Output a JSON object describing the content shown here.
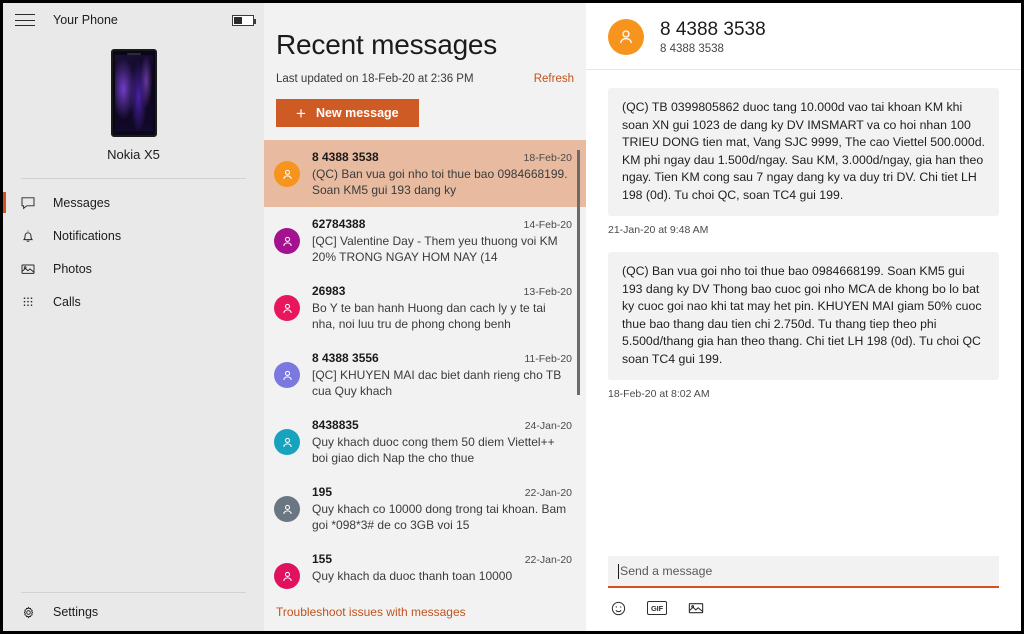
{
  "window": {
    "title": "Your Phone",
    "menu_icon": "hamburger-icon",
    "battery_icon": "battery-icon"
  },
  "sidebar": {
    "device": {
      "name": "Nokia X5",
      "thumbnail": "phone-thumbnail"
    },
    "items": [
      {
        "label": "Messages",
        "icon": "chat-bubble-icon",
        "active": true
      },
      {
        "label": "Notifications",
        "icon": "bell-icon",
        "active": false
      },
      {
        "label": "Photos",
        "icon": "photo-icon",
        "active": false
      },
      {
        "label": "Calls",
        "icon": "dialpad-icon",
        "active": false
      }
    ],
    "settings": {
      "label": "Settings",
      "icon": "gear-icon"
    }
  },
  "list_pane": {
    "title": "Recent messages",
    "last_updated": "Last updated on 18-Feb-20 at 2:36 PM",
    "refresh_label": "Refresh",
    "new_message_label": "New message",
    "new_message_plus": "+",
    "troubleshoot_label": "Troubleshoot issues with messages",
    "conversations": [
      {
        "name": "8 4388 3538",
        "date": "18-Feb-20",
        "preview": "(QC) Ban vua goi nho toi thue bao 0984668199. Soan KM5 gui 193 dang ky",
        "avatar_color": "#f7941d",
        "selected": true
      },
      {
        "name": "62784388",
        "date": "14-Feb-20",
        "preview": "[QC] Valentine Day - Them yeu thuong voi KM 20% TRONG NGAY HOM NAY (14",
        "avatar_color": "#a4128f",
        "selected": false
      },
      {
        "name": "26983",
        "date": "13-Feb-20",
        "preview": "Bo Y te ban hanh Huong dan cach ly y te tai nha, noi luu tru de phong chong benh",
        "avatar_color": "#e8175d",
        "selected": false
      },
      {
        "name": "8 4388 3556",
        "date": "11-Feb-20",
        "preview": "[QC] KHUYEN MAI dac biet danh rieng cho TB cua Quy khach",
        "avatar_color": "#7b79e0",
        "selected": false
      },
      {
        "name": "8438835",
        "date": "24-Jan-20",
        "preview": "Quy khach duoc cong them 50 diem Viettel++ boi giao dich Nap the cho thue",
        "avatar_color": "#17a2bd",
        "selected": false
      },
      {
        "name": "195",
        "date": "22-Jan-20",
        "preview": "Quy khach co 10000 dong trong tai khoan. Bam goi *098*3# de co 3GB voi 15",
        "avatar_color": "#6b7683",
        "selected": false
      },
      {
        "name": "155",
        "date": "22-Jan-20",
        "preview": "Quy khach da duoc thanh toan 10000",
        "avatar_color": "#e0115f",
        "selected": false
      }
    ]
  },
  "conversation": {
    "contact_name": "8 4388 3538",
    "contact_number": "8 4388 3538",
    "avatar_color": "#f7941d",
    "messages": [
      {
        "text": "(QC) TB 0399805862 duoc tang 10.000d vao tai khoan KM khi soan XN gui 1023 de dang ky DV IMSMART va co hoi nhan 100 TRIEU DONG tien mat, Vang SJC 9999, The cao Viettel 500.000d. KM phi ngay dau 1.500d/ngay. Sau KM, 3.000d/ngay, gia han theo ngay. Tien KM cong sau 7 ngay dang ky va duy tri DV. Chi tiet LH 198 (0d). Tu choi QC, soan TC4 gui 199.",
        "timestamp": "21-Jan-20 at 9:48 AM"
      },
      {
        "text": "(QC) Ban vua goi nho toi thue bao 0984668199. Soan KM5 gui 193 dang ky DV Thong bao cuoc goi nho MCA de khong bo lo bat ky cuoc goi nao khi tat may het pin. KHUYEN MAI giam 50% cuoc thue bao thang dau tien chi 2.750d. Tu thang tiep theo phi 5.500d/thang gia han theo thang. Chi tiet LH 198 (0d). Tu choi QC soan TC4 gui 199.",
        "timestamp": "18-Feb-20 at 8:02 AM"
      }
    ],
    "composer": {
      "placeholder": "Send a message",
      "value": "",
      "tools": [
        {
          "name": "emoji-icon",
          "label": ""
        },
        {
          "name": "gif-icon",
          "label": "GIF"
        },
        {
          "name": "image-icon",
          "label": ""
        }
      ]
    }
  },
  "colors": {
    "accent": "#d8511d",
    "button": "#cf5b24",
    "selected_row": "#e8bba0",
    "sidebar_bg": "#e9e9e9",
    "list_bg": "#f2f2f2"
  }
}
